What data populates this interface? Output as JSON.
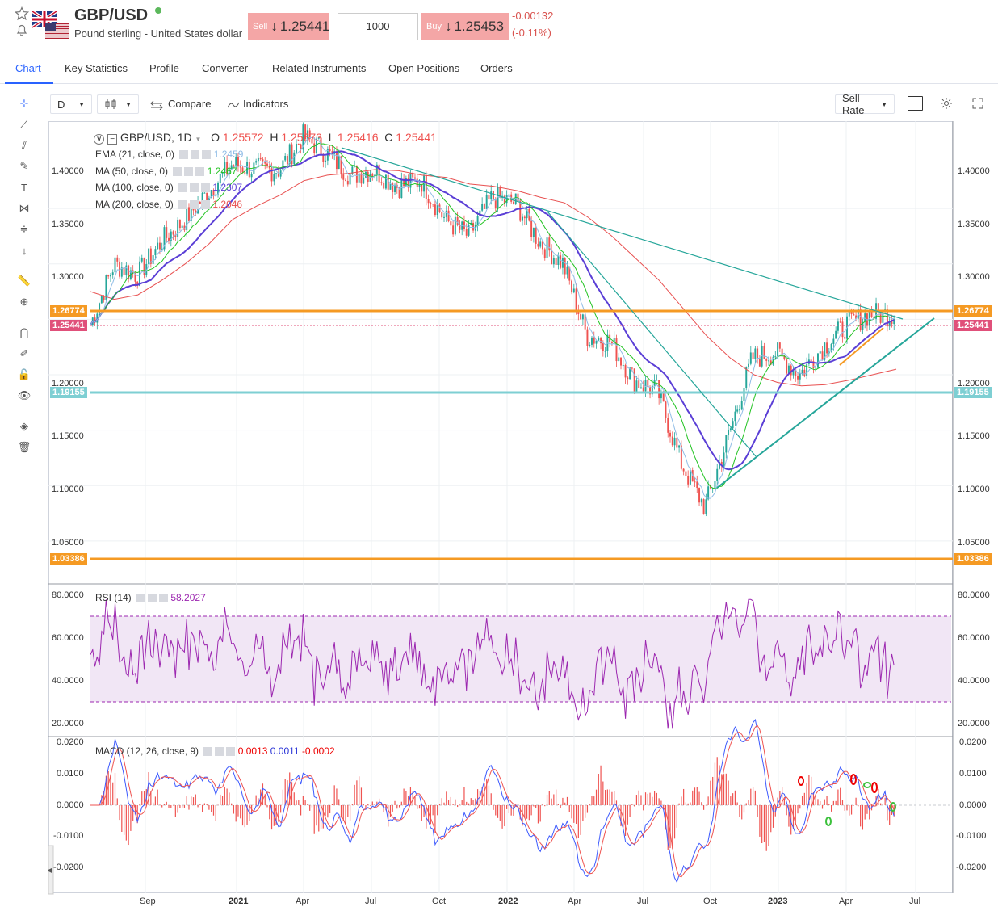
{
  "header": {
    "pair": "GBP/USD",
    "description": "Pound sterling - United States dollar",
    "sell_label": "Sell",
    "sell_arrow": "↓",
    "sell_price": "1.25441",
    "quantity": "1000",
    "buy_label": "Buy",
    "buy_arrow": "↓",
    "buy_price": "1.25453",
    "change": "-0.00132",
    "change_pct": "(-0.11%)",
    "colors": {
      "sell_bg": "#f4a6a6",
      "status": "#5cb85c",
      "negative": "#d9534f"
    }
  },
  "tabs": [
    "Chart",
    "Key Statistics",
    "Profile",
    "Converter",
    "Related Instruments",
    "Open Positions",
    "Orders"
  ],
  "toolbar": {
    "interval": "D",
    "compare_label": "Compare",
    "indicators_label": "Indicators",
    "rate_label": "Sell Rate"
  },
  "legend": {
    "symbol": "GBP/USD, 1D",
    "o_label": "O",
    "o": "1.25572",
    "h_label": "H",
    "h": "1.25673",
    "l_label": "L",
    "l": "1.25416",
    "c_label": "C",
    "c": "1.25441",
    "ema": {
      "label": "EMA (21, close, 0)",
      "value": "1.2459",
      "color": "#8fbce6"
    },
    "ma50": {
      "label": "MA (50, close, 0)",
      "value": "1.2467",
      "color": "#22c322"
    },
    "ma100": {
      "label": "MA (100, close, 0)",
      "value": "1.2307",
      "color": "#5b3fd6"
    },
    "ma200": {
      "label": "MA (200, close, 0)",
      "value": "1.2046",
      "color": "#e85050"
    },
    "rsi": {
      "label": "RSI (14)",
      "value": "58.2027",
      "color": "#9c27b0"
    },
    "macd": {
      "label": "MACD (12, 26, close, 9)",
      "v1": "0.0013",
      "v2": "0.0011",
      "v3": "-0.0002"
    }
  },
  "price_axis": [
    "1.40000",
    "1.35000",
    "1.30000",
    "1.20000",
    "1.15000",
    "1.10000",
    "1.05000"
  ],
  "price_tags": {
    "resistance": "1.26774",
    "last": "1.25441",
    "support_mid": "1.19155",
    "support_low": "1.03386"
  },
  "rsi_axis": [
    "80.0000",
    "60.0000",
    "40.0000",
    "20.0000"
  ],
  "macd_axis": [
    "0.0200",
    "0.0100",
    "0.0000",
    "-0.0100",
    "-0.0200"
  ],
  "time_axis": [
    "Sep",
    "2021",
    "Apr",
    "Jul",
    "Oct",
    "2022",
    "Apr",
    "Jul",
    "Oct",
    "2023",
    "Apr",
    "Jul"
  ],
  "chart_data": {
    "type": "line",
    "title": "GBP/USD, 1D",
    "x": [
      "2020-08",
      "2020-09",
      "2020-10",
      "2020-11",
      "2020-12",
      "2021-01",
      "2021-02",
      "2021-03",
      "2021-04",
      "2021-05",
      "2021-06",
      "2021-07",
      "2021-08",
      "2021-09",
      "2021-10",
      "2021-11",
      "2021-12",
      "2022-01",
      "2022-02",
      "2022-03",
      "2022-04",
      "2022-05",
      "2022-06",
      "2022-07",
      "2022-08",
      "2022-09",
      "2022-10",
      "2022-11",
      "2022-12",
      "2023-01",
      "2023-02",
      "2023-03",
      "2023-04",
      "2023-05",
      "2023-06"
    ],
    "series": [
      {
        "name": "GBP/USD",
        "values": [
          1.245,
          1.3,
          1.29,
          1.32,
          1.34,
          1.365,
          1.39,
          1.385,
          1.385,
          1.415,
          1.4,
          1.38,
          1.385,
          1.37,
          1.375,
          1.34,
          1.325,
          1.36,
          1.355,
          1.32,
          1.3,
          1.235,
          1.23,
          1.195,
          1.185,
          1.12,
          1.08,
          1.145,
          1.215,
          1.22,
          1.2,
          1.225,
          1.245,
          1.255,
          1.254
        ]
      },
      {
        "name": "MA (200, close, 0)",
        "values": [
          1.275,
          1.268,
          1.272,
          1.285,
          1.3,
          1.318,
          1.34,
          1.352,
          1.362,
          1.375,
          1.38,
          1.382,
          1.385,
          1.384,
          1.38,
          1.378,
          1.372,
          1.37,
          1.366,
          1.36,
          1.355,
          1.342,
          1.325,
          1.305,
          1.285,
          1.26,
          1.235,
          1.215,
          1.2,
          1.193,
          1.19,
          1.191,
          1.195,
          1.2,
          1.205
        ]
      }
    ],
    "ylim": [
      1.03386,
      1.42
    ],
    "grid": true,
    "legend_position": "top-left"
  }
}
